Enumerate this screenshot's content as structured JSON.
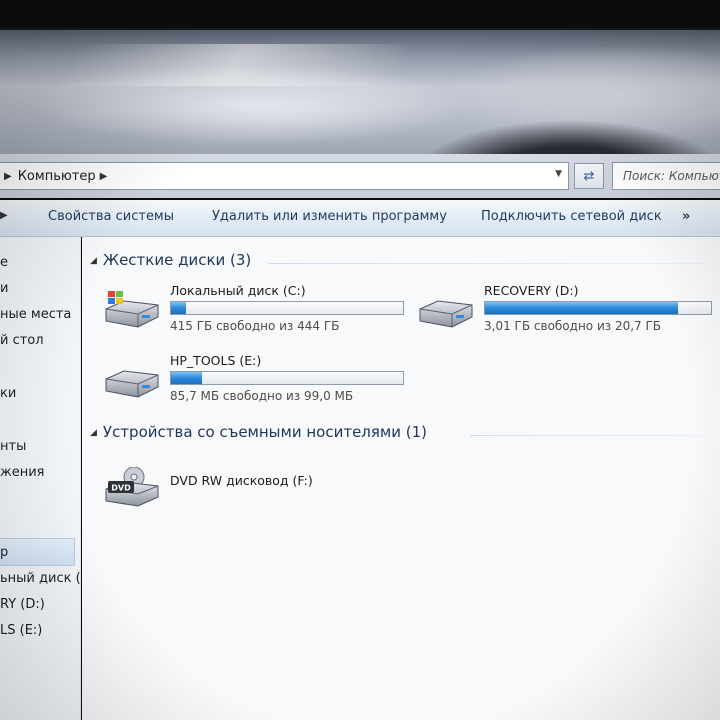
{
  "address_bar": {
    "path_label": "Компьютер",
    "search_placeholder": "Поиск: Компьютер"
  },
  "command_bar": {
    "items": [
      "Свойства системы",
      "Удалить или изменить программу",
      "Подключить сетевой диск"
    ],
    "overflow": "»"
  },
  "nav_pane": {
    "items": [
      "е",
      "и",
      "ные места",
      "й стол",
      "ки",
      "нты",
      "жения",
      "р",
      "ьный диск (С",
      "RY (D:)",
      "LS (E:)"
    ],
    "selected": "р"
  },
  "groups": {
    "hard_drives": {
      "title": "Жесткие диски (3)",
      "drives": [
        {
          "name": "Локальный диск (C:)",
          "free_text": "415 ГБ свободно из 444 ГБ",
          "used_fraction": 0.065,
          "icon": "windows-drive-icon"
        },
        {
          "name": "RECOVERY (D:)",
          "free_text": "3,01 ГБ свободно из 20,7 ГБ",
          "used_fraction": 0.855,
          "icon": "hard-drive-icon"
        },
        {
          "name": "HP_TOOLS (E:)",
          "free_text": "85,7 МБ свободно из 99,0 МБ",
          "used_fraction": 0.134,
          "icon": "hard-drive-icon"
        }
      ]
    },
    "removable": {
      "title": "Устройства со съемными носителями (1)",
      "devices": [
        {
          "name": "DVD RW дисковод (F:)",
          "icon_label": "DVD",
          "icon": "dvd-drive-icon"
        }
      ]
    }
  },
  "colors": {
    "progress_fill": "#2b8ad8",
    "command_text": "#1e3a5c",
    "header_text": "#1e3559"
  }
}
